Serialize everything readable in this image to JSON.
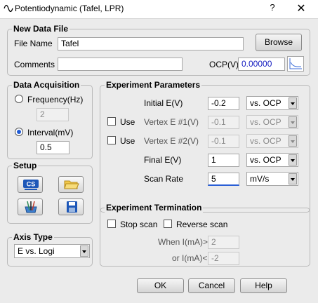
{
  "window": {
    "title": "Potentiodynamic (Tafel, LPR)",
    "help": "?",
    "close": "✕"
  },
  "new_data_file": {
    "legend": "New Data File",
    "file_name_label": "File Name",
    "file_name_value": "Tafel",
    "browse_label": "Browse",
    "comments_label": "Comments",
    "comments_value": "",
    "ocp_label": "OCP(V)",
    "ocp_value": "0.00000"
  },
  "data_acquisition": {
    "legend": "Data Acquisition",
    "frequency_label": "Frequency(Hz)",
    "frequency_value": "2",
    "interval_label": "Interval(mV)",
    "interval_value": "0.5",
    "selected": "interval"
  },
  "experiment_parameters": {
    "legend": "Experiment Parameters",
    "initial_label": "Initial E(V)",
    "initial_value": "-0.2",
    "initial_ref": "vs. OCP",
    "use1_label": "Use",
    "vertex1_label": "Vertex E #1(V)",
    "vertex1_value": "-0.1",
    "vertex1_ref": "vs. OCP",
    "use2_label": "Use",
    "vertex2_label": "Vertex E #2(V)",
    "vertex2_value": "-0.1",
    "vertex2_ref": "vs. OCP",
    "final_label": "Final E(V)",
    "final_value": "1",
    "final_ref": "vs. OCP",
    "scan_rate_label": "Scan Rate",
    "scan_rate_value": "5",
    "scan_rate_unit": "mV/s"
  },
  "setup": {
    "legend": "Setup",
    "icons": [
      "cell-setup-icon",
      "open-folder-icon",
      "electrode-icon",
      "save-disk-icon"
    ],
    "cs_text": "CS"
  },
  "experiment_termination": {
    "legend": "Experiment Termination",
    "stop_scan_label": "Stop scan",
    "reverse_scan_label": "Reverse scan",
    "when_label": "When I(mA)>",
    "when_value": "2",
    "or_label": "or I(mA)<",
    "or_value": "-2"
  },
  "axis_type": {
    "legend": "Axis Type",
    "value": "E vs. Logi"
  },
  "footer": {
    "ok": "OK",
    "cancel": "Cancel",
    "help": "Help"
  },
  "colors": {
    "background": "#ebebeb",
    "accent_blue": "#1f5bd6",
    "ocp_text": "#1a22c2"
  }
}
